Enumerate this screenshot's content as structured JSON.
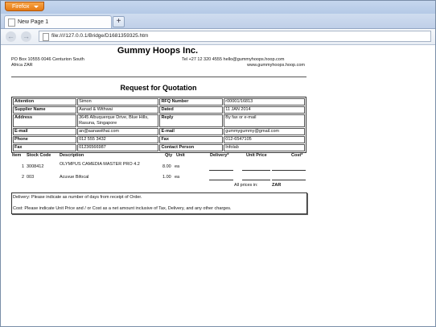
{
  "browser": {
    "app_button": "Firefox",
    "tab_title": "New Page 1",
    "new_tab": "+",
    "back": "←",
    "forward": "→",
    "url": "file:////127.0.0.1/Bridge/D1681359325.htm"
  },
  "doc": {
    "company": "Gummy Hoops Inc.",
    "address_line1": "PO Box 10555 0046 Centurion South",
    "address_line2": "Africa ZAR",
    "contact_line1": "Tel +27 12 320 4555 hello@gummyhoops.hoop.com",
    "contact_line2": "www.gummyhoops.hoop.com",
    "title": "Request for Quotation",
    "info_rows": [
      [
        "Attention",
        "Simon",
        "RFQ Number",
        "r00001/16813"
      ],
      [
        "Supplier Name",
        "Aanad & Withwai",
        "Dated",
        "11 JAN 2014"
      ],
      [
        "Address",
        "3645 Albuquerque Drive, Blue Hills, Rasuna, Singapore",
        "Reply",
        "By fax or e-mail"
      ],
      [
        "E-mail",
        "an@aanawithai.com",
        "E-mail",
        "gummygummy@gmail.com"
      ],
      [
        "Phone",
        "012 555 3432",
        "Fax",
        "012-6547105"
      ],
      [
        "Fax",
        "01236566987",
        "Contact Person",
        "Infolab"
      ]
    ],
    "items_header": {
      "item": "Item",
      "stock_code": "Stock Code",
      "description": "Description",
      "qty": "Qty",
      "unit": "Unit",
      "delivery": "Delivery*",
      "unit_price": "Unit Price",
      "cost": "Cost*"
    },
    "items": [
      {
        "item": "1",
        "stock_code": "3008412",
        "description": "OLYMPUS CAMEDIA MASTER PRO 4.2",
        "qty": "8.00",
        "unit": "ea"
      },
      {
        "item": "2",
        "stock_code": "003",
        "description": "Acuvue Bifocal",
        "qty": "1.00",
        "unit": "ea"
      }
    ],
    "all_prices_label": "All prices in:",
    "currency": "ZAR",
    "note_delivery": "Delivery: Please indicate as number of days from receipt of Order.",
    "note_cost": "Cost: Please indicate Unit Price and / or Cost as a net amount inclusive of Tax, Delivery, and any other charges."
  }
}
